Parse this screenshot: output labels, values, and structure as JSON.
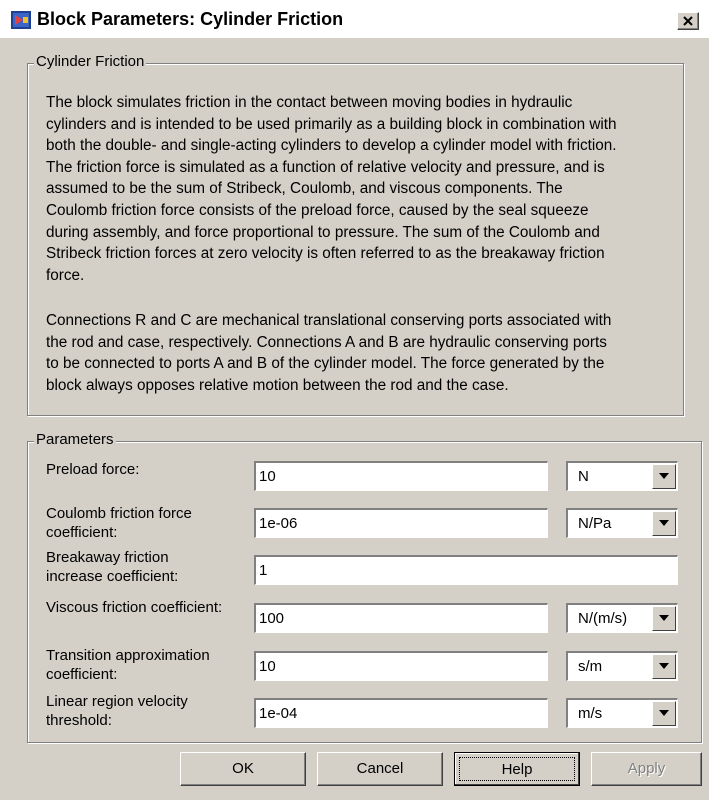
{
  "window": {
    "title": "Block Parameters: Cylinder Friction",
    "close_icon": "close-x-icon",
    "app_icon": "simulink-block-icon"
  },
  "description_group": {
    "legend": "Cylinder Friction",
    "paragraph1": [
      "The block simulates friction in the contact between moving bodies in hydraulic",
      "cylinders and is intended to be used primarily as a building block in combination with",
      "both the double- and single-acting cylinders to develop a cylinder model with friction.",
      "The friction force is simulated as a function of relative velocity and pressure, and is",
      "assumed to be the sum of Stribeck, Coulomb, and viscous components. The",
      "Coulomb friction force consists of the preload force, caused by the seal squeeze",
      "during assembly, and force proportional to pressure. The sum of the Coulomb and",
      "Stribeck friction forces at zero velocity is often referred to as the breakaway friction",
      "force."
    ],
    "paragraph2": [
      "Connections R and C are mechanical translational conserving ports associated with",
      "the rod and case, respectively. Connections A and B are hydraulic conserving ports",
      "to be connected to ports A and B of the cylinder model. The force generated by the",
      "block always opposes relative motion between the rod and the case."
    ]
  },
  "parameters_group": {
    "legend": "Parameters",
    "preload_force": {
      "label": "Preload force:",
      "value": "10",
      "unit": "N"
    },
    "coulomb_coeff": {
      "label_line1": "Coulomb friction force",
      "label_line2": "coefficient:",
      "value": "1e-06",
      "unit": "N/Pa"
    },
    "breakaway_coeff": {
      "label_line1": "Breakaway friction",
      "label_line2": "increase coefficient:",
      "value": "1"
    },
    "viscous_coeff": {
      "label": "Viscous friction coefficient:",
      "value": "100",
      "unit": "N/(m/s)"
    },
    "transition_coeff": {
      "label_line1": "Transition approximation",
      "label_line2": "coefficient:",
      "value": "10",
      "unit": "s/m"
    },
    "linear_threshold": {
      "label_line1": "Linear region velocity",
      "label_line2": "threshold:",
      "value": "1e-04",
      "unit": "m/s"
    }
  },
  "buttons": {
    "ok": "OK",
    "cancel": "Cancel",
    "help": "Help",
    "apply": "Apply"
  },
  "colors": {
    "dialog_face": "#d4d0c8",
    "title_bg": "#ffffff",
    "field_bg": "#ffffff"
  }
}
